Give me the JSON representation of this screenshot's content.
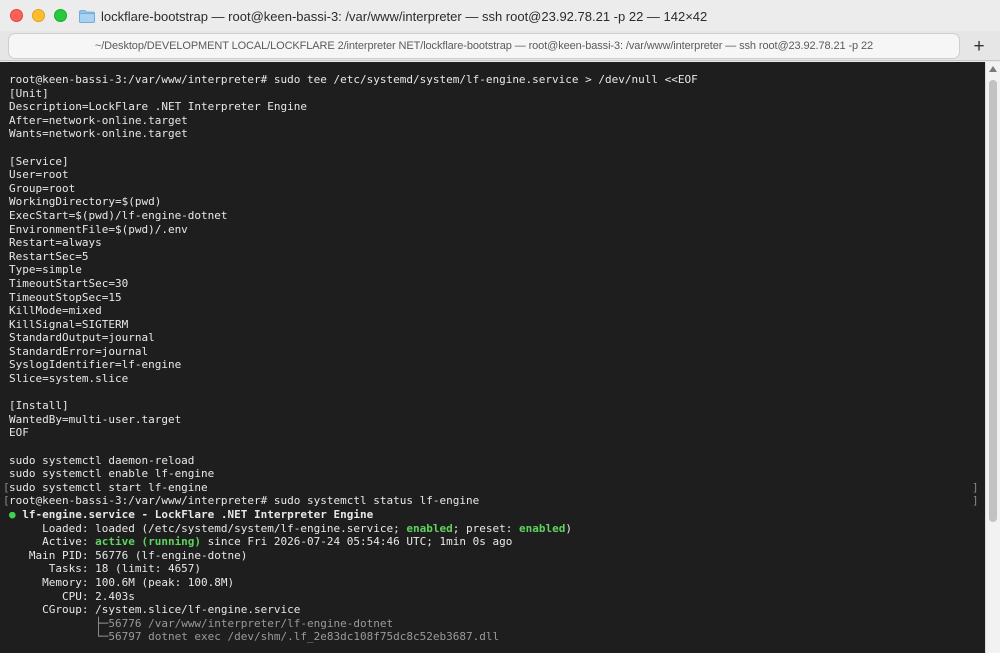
{
  "window": {
    "title": "lockflare-bootstrap — root@keen-bassi-3: /var/www/interpreter — ssh root@23.92.78.21 -p 22 — 142×42"
  },
  "tab": {
    "label": "~/Desktop/DEVELOPMENT LOCAL/LOCKFLARE 2/interpreter NET/lockflare-bootstrap — root@keen-bassi-3: /var/www/interpreter — ssh root@23.92.78.21 -p 22",
    "new_tab_label": "+"
  },
  "colors": {
    "terminal_bg": "#1e1e1e",
    "terminal_fg": "#e8e8e8",
    "status_green": "#5fd35f"
  },
  "terminal": {
    "lines": [
      "root@keen-bassi-3:/var/www/interpreter# sudo tee /etc/systemd/system/lf-engine.service > /dev/null <<EOF",
      "[Unit]",
      "Description=LockFlare .NET Interpreter Engine",
      "After=network-online.target",
      "Wants=network-online.target",
      "",
      "[Service]",
      "User=root",
      "Group=root",
      "WorkingDirectory=$(pwd)",
      "ExecStart=$(pwd)/lf-engine-dotnet",
      "EnvironmentFile=$(pwd)/.env",
      "Restart=always",
      "RestartSec=5",
      "Type=simple",
      "TimeoutStartSec=30",
      "TimeoutStopSec=15",
      "KillMode=mixed",
      "KillSignal=SIGTERM",
      "StandardOutput=journal",
      "StandardError=journal",
      "SyslogIdentifier=lf-engine",
      "Slice=system.slice",
      "",
      "[Install]",
      "WantedBy=multi-user.target",
      "EOF",
      "",
      "sudo systemctl daemon-reload",
      "sudo systemctl enable lf-engine",
      "sudo systemctl start lf-engine",
      "root@keen-bassi-3:/var/www/interpreter# sudo systemctl status lf-engine"
    ],
    "status": {
      "bullet": "●",
      "unit_line": " lf-engine.service - LockFlare .NET Interpreter Engine",
      "loaded_prefix": "     Loaded: loaded (/etc/systemd/system/lf-engine.service; ",
      "loaded_enabled": "enabled",
      "loaded_mid": "; preset: ",
      "loaded_preset": "enabled",
      "loaded_suffix": ")",
      "active_prefix": "     Active: ",
      "active_state": "active (running)",
      "active_suffix": " since Fri 2026-07-24 05:54:46 UTC; 1min 0s ago",
      "main_pid": "   Main PID: 56776 (lf-engine-dotne)",
      "tasks": "      Tasks: 18 (limit: 4657)",
      "memory": "     Memory: 100.6M (peak: 100.8M)",
      "cpu": "        CPU: 2.403s",
      "cgroup": "     CGroup: /system.slice/lf-engine.service",
      "tree_1_prefix": "             ├─",
      "tree_1": "56776 /var/www/interpreter/lf-engine-dotnet",
      "tree_2_prefix": "             └─",
      "tree_2": "56797 dotnet exec /dev/shm/.lf_2e83dc108f75dc8c52eb3687.dll"
    },
    "bracket_left": "[",
    "bracket_right": "]"
  }
}
